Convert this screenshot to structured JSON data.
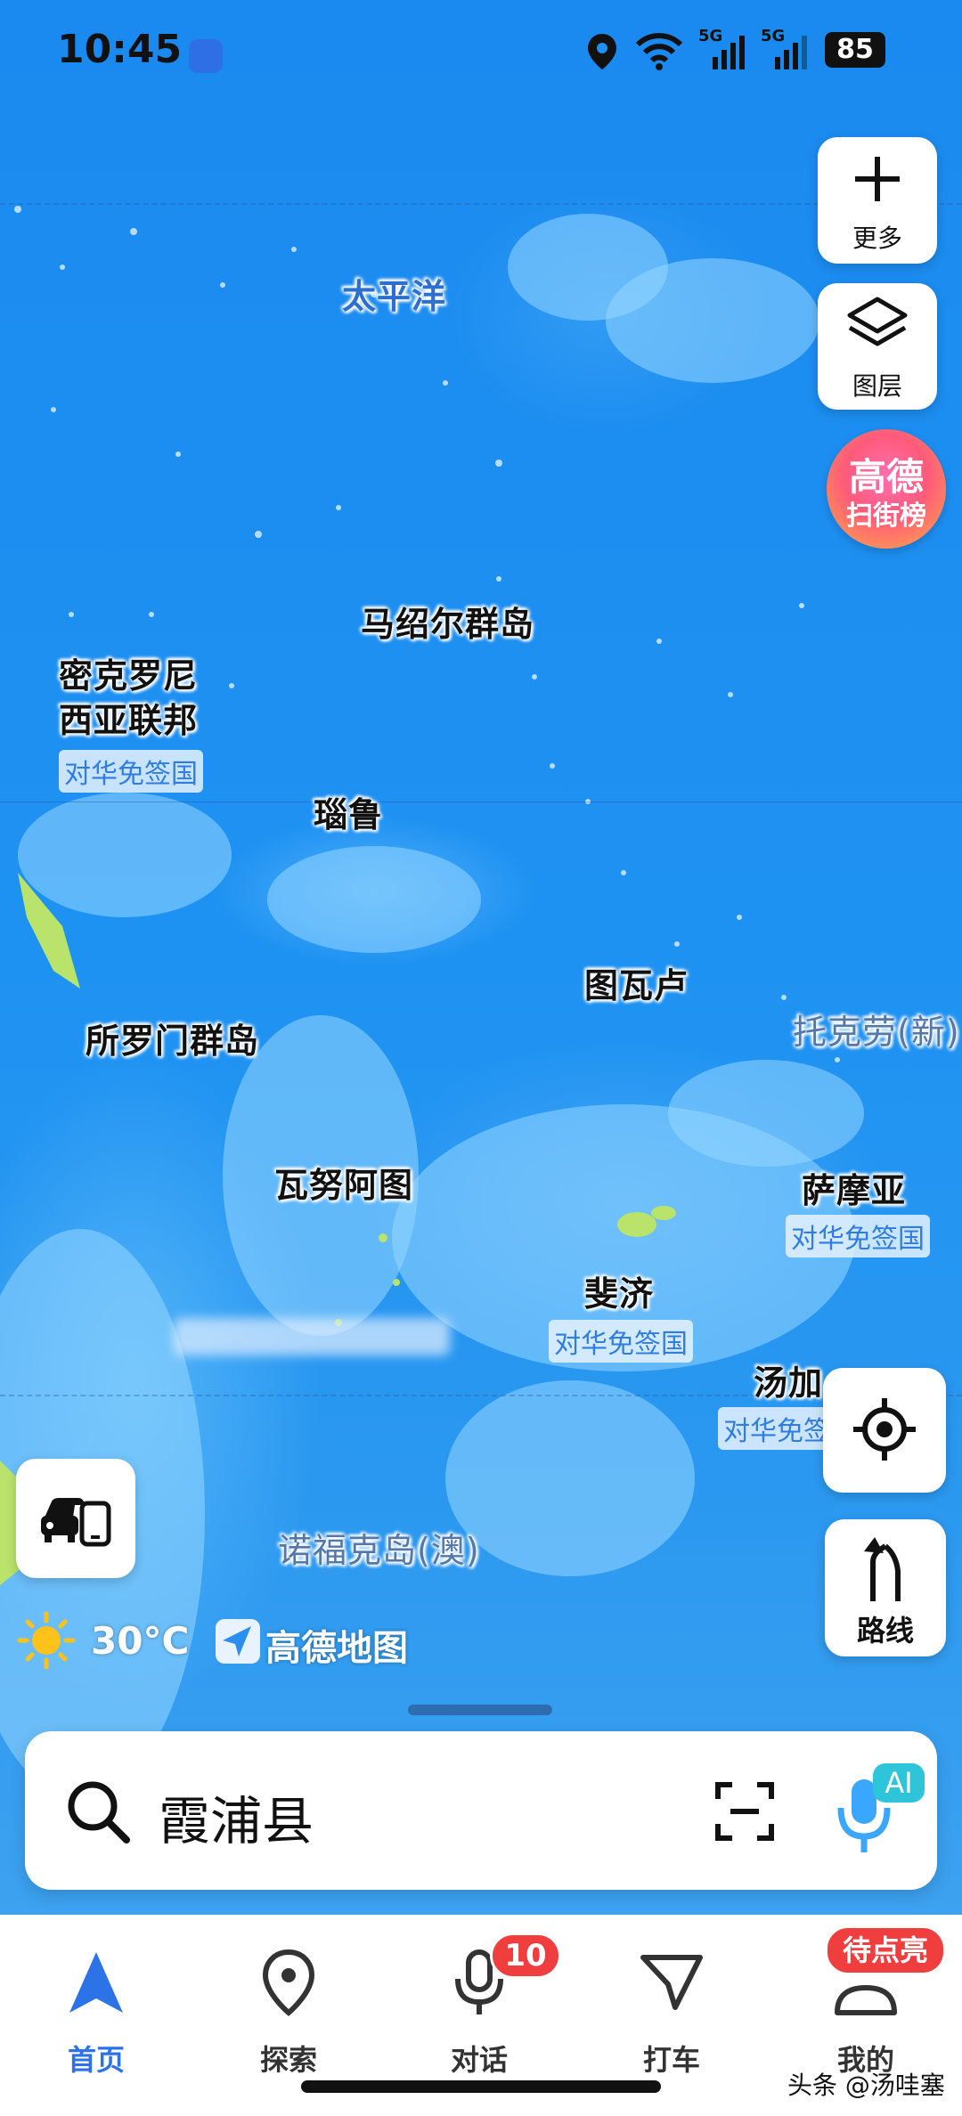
{
  "status_bar": {
    "time": "10:45",
    "battery": "85",
    "signal1_label": "5G",
    "signal2_label": "5G"
  },
  "map": {
    "places": {
      "pacific": "太平洋",
      "marshall": "马绍尔群岛",
      "micronesia_line1": "密克罗尼",
      "micronesia_line2": "西亚联邦",
      "nauru": "瑙鲁",
      "tuvalu": "图瓦卢",
      "tokelau": "托克劳(新)",
      "solomon": "所罗门群岛",
      "vanuatu": "瓦努阿图",
      "samoa": "萨摩亚",
      "fiji": "斐济",
      "tonga": "汤加",
      "norfolk": "诺福克岛(澳)"
    },
    "visa_free_label": "对华免签国",
    "visa_free_label_cut": "对华免签"
  },
  "controls": {
    "more_label": "更多",
    "layers_label": "图层",
    "scan_line1": "高德",
    "scan_line2": "扫街榜",
    "route_label": "路线"
  },
  "weather": {
    "temperature": "30°C",
    "brand": "高德地图"
  },
  "search": {
    "text": "霞浦县",
    "ai_badge": "AI"
  },
  "nav": {
    "tabs": [
      {
        "label": "首页",
        "icon": "navigation-arrow-icon",
        "active": true
      },
      {
        "label": "探索",
        "icon": "location-pin-icon"
      },
      {
        "label": "对话",
        "icon": "microphone-icon",
        "badge": "10"
      },
      {
        "label": "打车",
        "icon": "taxi-arrow-icon"
      },
      {
        "label": "我的",
        "icon": "profile-icon",
        "badge": "待点亮"
      }
    ]
  },
  "watermark": "头条 @汤哇塞",
  "colors": {
    "ocean": "#1f8ff0",
    "accent": "#2c73e8",
    "badge": "#f03d3d"
  }
}
